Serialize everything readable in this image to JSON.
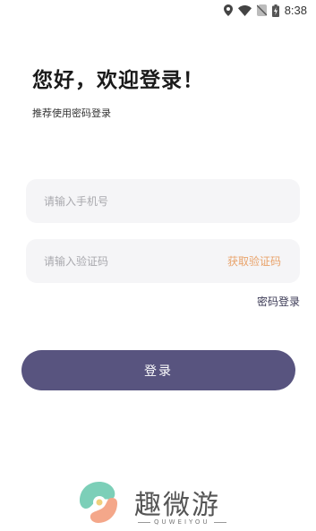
{
  "status_bar": {
    "time": "8:38",
    "icons": [
      "location-icon",
      "wifi-icon",
      "no-sim-icon",
      "battery-charging-icon"
    ]
  },
  "header": {
    "welcome": "您好，欢迎登录！",
    "subtitle": "推荐使用密码登录"
  },
  "form": {
    "phone_placeholder": "请输入手机号",
    "code_placeholder": "请输入验证码",
    "get_code_label": "获取验证码",
    "password_login_label": "密码登录",
    "login_button_label": "登录"
  },
  "brand": {
    "name": "趣微游",
    "tagline": "QUWEIYOU"
  },
  "colors": {
    "accent_button": "#58547f",
    "get_code": "#e9a36b",
    "field_bg": "#f5f5f7"
  }
}
